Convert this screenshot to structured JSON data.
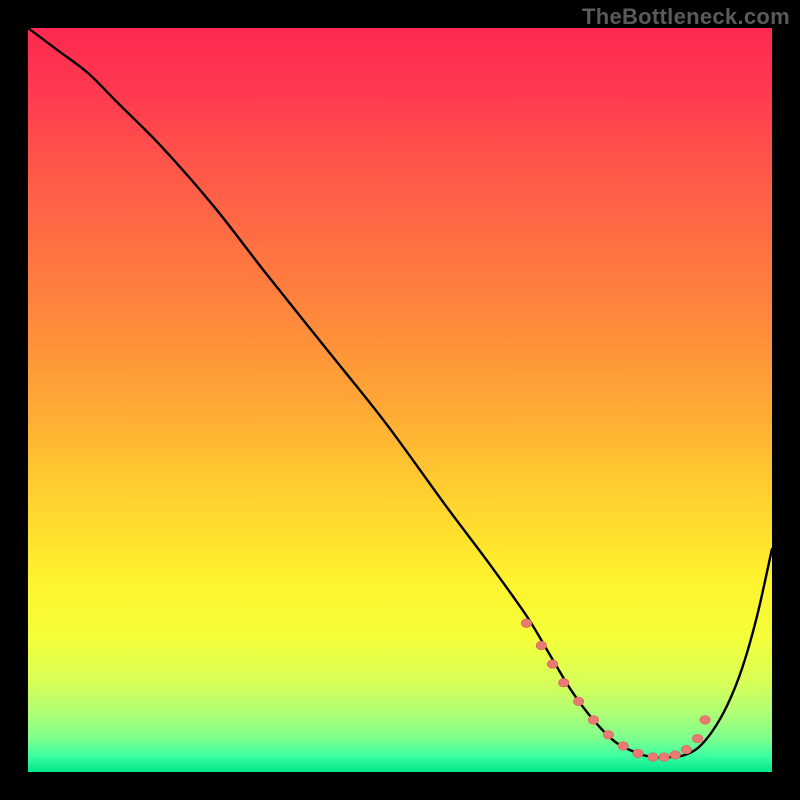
{
  "watermark": "TheBottleneck.com",
  "colors": {
    "page_bg": "#000000",
    "curve": "#000000",
    "dot_fill": "#e77b74",
    "dot_stroke": "#d85f58"
  },
  "chart_data": {
    "type": "line",
    "title": "",
    "xlabel": "",
    "ylabel": "",
    "xlim": [
      0,
      100
    ],
    "ylim": [
      0,
      100
    ],
    "grid": false,
    "gradient_stops": [
      {
        "offset": 0.0,
        "color": "#ff2950"
      },
      {
        "offset": 0.08,
        "color": "#ff3850"
      },
      {
        "offset": 0.2,
        "color": "#ff5a49"
      },
      {
        "offset": 0.35,
        "color": "#ff7e3e"
      },
      {
        "offset": 0.5,
        "color": "#ffa636"
      },
      {
        "offset": 0.62,
        "color": "#ffce2f"
      },
      {
        "offset": 0.74,
        "color": "#fff22e"
      },
      {
        "offset": 0.82,
        "color": "#f4ff3a"
      },
      {
        "offset": 0.88,
        "color": "#d7ff58"
      },
      {
        "offset": 0.92,
        "color": "#b0ff74"
      },
      {
        "offset": 0.955,
        "color": "#7dff8e"
      },
      {
        "offset": 0.978,
        "color": "#3fffa3"
      },
      {
        "offset": 1.0,
        "color": "#00e58b"
      }
    ],
    "series": [
      {
        "name": "bottleneck-curve",
        "x": [
          0,
          4,
          8,
          12,
          18,
          25,
          32,
          40,
          48,
          56,
          62,
          67,
          70,
          73,
          76,
          79,
          82,
          84,
          86,
          88,
          90,
          92,
          94,
          96,
          98,
          100
        ],
        "y": [
          100,
          97,
          94,
          90,
          84,
          76,
          67,
          57,
          47,
          36,
          28,
          21,
          16,
          11,
          7,
          4,
          2.5,
          2,
          2,
          2.2,
          3.2,
          5.5,
          9,
          14,
          21,
          30
        ]
      }
    ],
    "highlight_dots": {
      "x": [
        67,
        69,
        70.5,
        72,
        74,
        76,
        78,
        80,
        82,
        84,
        85.5,
        87,
        88.5,
        90,
        91
      ],
      "y": [
        20,
        17,
        14.5,
        12,
        9.5,
        7,
        5,
        3.5,
        2.5,
        2,
        2,
        2.3,
        3,
        4.5,
        7
      ],
      "r": 5.2
    }
  }
}
